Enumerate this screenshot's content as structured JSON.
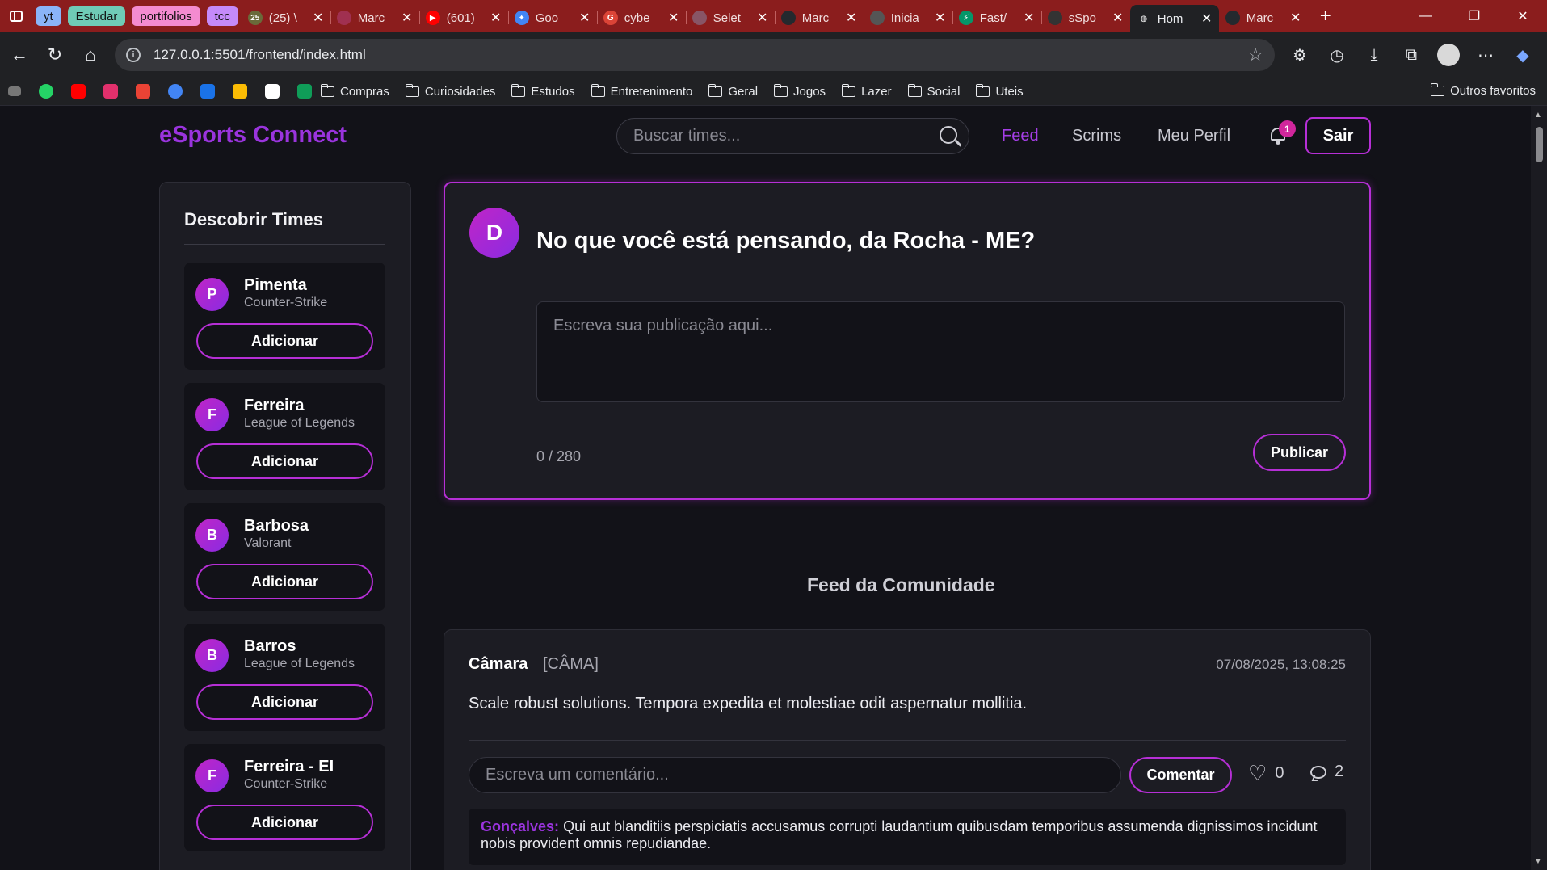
{
  "browser": {
    "tab_groups": [
      {
        "label": "yt",
        "color": "#8ab4f8"
      },
      {
        "label": "Estudar",
        "color": "#6fcbb6"
      },
      {
        "label": "portifolios",
        "color": "#f48bd0"
      },
      {
        "label": "tcc",
        "color": "#c58af9"
      }
    ],
    "tabs": [
      {
        "title": "(25) \\",
        "favicon_color": "#6a6a3a",
        "favicon": "25"
      },
      {
        "title": "Marc",
        "favicon_color": "#a03050",
        "favicon": ""
      },
      {
        "title": "(601)",
        "favicon_color": "#ff0000",
        "favicon": "▶"
      },
      {
        "title": "Goo",
        "favicon_color": "#4285f4",
        "favicon": "✦"
      },
      {
        "title": "cybe",
        "favicon_color": "#db4437",
        "favicon": "G"
      },
      {
        "title": "Selet",
        "favicon_color": "#885566",
        "favicon": ""
      },
      {
        "title": "Marc",
        "favicon_color": "#24292e",
        "favicon": ""
      },
      {
        "title": "Inicia",
        "favicon_color": "#555555",
        "favicon": ""
      },
      {
        "title": "Fast/",
        "favicon_color": "#059669",
        "favicon": "⚡"
      },
      {
        "title": "sSpo",
        "favicon_color": "#333333",
        "favicon": ""
      },
      {
        "title": "Hom",
        "favicon_color": "#202124",
        "favicon": "◍",
        "active": true
      },
      {
        "title": "Marc",
        "favicon_color": "#24292e",
        "favicon": ""
      }
    ],
    "url": "127.0.0.1:5501/frontend/index.html",
    "bookmark_folders": [
      "Compras",
      "Curiosidades",
      "Estudos",
      "Entretenimento",
      "Geral",
      "Jogos",
      "Lazer",
      "Social",
      "Uteis"
    ],
    "other_bookmarks": "Outros favoritos"
  },
  "site": {
    "logo": "eSports Connect",
    "search_placeholder": "Buscar times...",
    "nav": {
      "feed": "Feed",
      "scrims": "Scrims",
      "profile": "Meu Perfil"
    },
    "notifications_count": "1",
    "logout": "Sair",
    "accent": "#b62fd6"
  },
  "sidebar": {
    "title": "Descobrir Times",
    "add_label": "Adicionar",
    "teams": [
      {
        "initial": "P",
        "name": "Pimenta",
        "game": "Counter-Strike"
      },
      {
        "initial": "F",
        "name": "Ferreira",
        "game": "League of Legends"
      },
      {
        "initial": "B",
        "name": "Barbosa",
        "game": "Valorant"
      },
      {
        "initial": "B",
        "name": "Barros",
        "game": "League of Legends"
      },
      {
        "initial": "F",
        "name": "Ferreira - EI",
        "game": "Counter-Strike"
      }
    ]
  },
  "composer": {
    "avatar_initial": "D",
    "prompt": "No que você está pensando, da Rocha - ME?",
    "placeholder": "Escreva sua publicação aqui...",
    "counter": "0 / 280",
    "publish": "Publicar"
  },
  "feed": {
    "title": "Feed da Comunidade",
    "post": {
      "author": "Câmara",
      "tag": "[CÂMA]",
      "timestamp": "07/08/2025, 13:08:25",
      "content": "Scale robust solutions. Tempora expedita et molestiae odit aspernatur mollitia.",
      "comment_placeholder": "Escreva um comentário...",
      "comment_button": "Comentar",
      "likes": "0",
      "comments": "2",
      "first_comment": {
        "author": "Gonçalves:",
        "text": "Qui aut blanditiis perspiciatis accusamus corrupti laudantium quibusdam temporibus assumenda dignissimos incidunt nobis provident omnis repudiandae."
      }
    }
  }
}
